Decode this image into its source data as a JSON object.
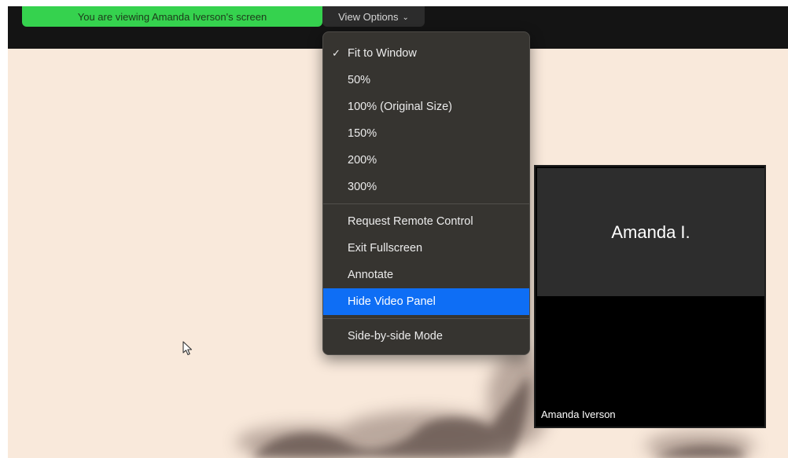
{
  "banner": {
    "text": "You are viewing Amanda Iverson's screen"
  },
  "view_options": {
    "label": "View Options",
    "icon": "chevron-down-icon"
  },
  "menu": {
    "zoom_items": [
      {
        "label": "Fit to Window",
        "checked": true
      },
      {
        "label": "50%"
      },
      {
        "label": "100% (Original Size)"
      },
      {
        "label": "150%"
      },
      {
        "label": "200%"
      },
      {
        "label": "300%"
      }
    ],
    "action_items": [
      {
        "label": "Request Remote Control"
      },
      {
        "label": "Exit Fullscreen"
      },
      {
        "label": "Annotate"
      },
      {
        "label": "Hide Video Panel",
        "highlighted": true
      }
    ],
    "mode_items": [
      {
        "label": "Side-by-side Mode"
      }
    ]
  },
  "video_panel": {
    "display_name": "Amanda I.",
    "participant_name": "Amanda Iverson"
  },
  "colors": {
    "banner_green": "#35d24e",
    "highlight_blue": "#0e6ef5",
    "menu_bg": "#363430",
    "screen_bg": "#f9e9db"
  }
}
